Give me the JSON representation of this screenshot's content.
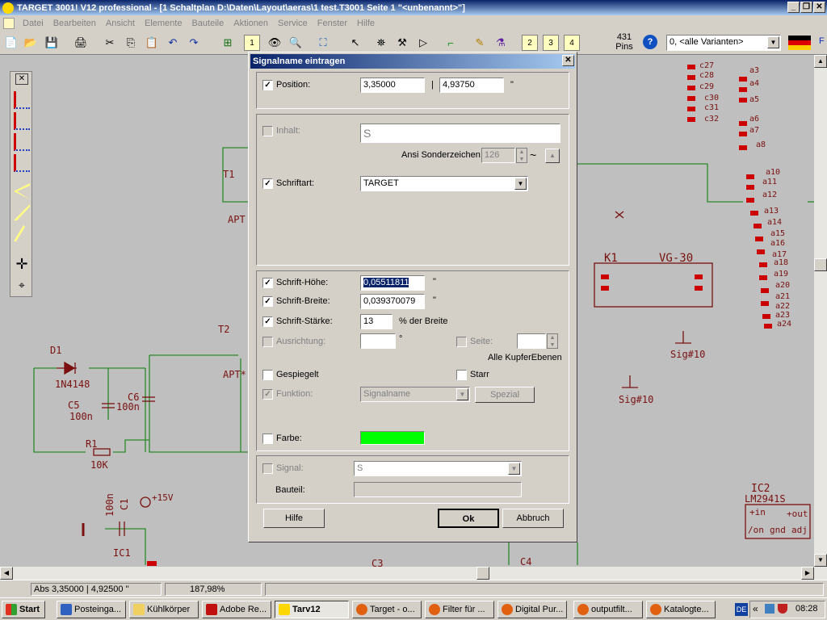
{
  "window": {
    "title": "TARGET 3001! V12 professional - [1 Schaltplan D:\\Daten\\Layout\\aeras\\1 test.T3001 Seite 1 \"<unbenannt>\"]"
  },
  "menu": [
    "Datei",
    "Bearbeiten",
    "Ansicht",
    "Elemente",
    "Bauteile",
    "Aktionen",
    "Service",
    "Fenster",
    "Hilfe"
  ],
  "toolbar": {
    "pins_count": "431",
    "pins_label": "Pins",
    "variant_select": "0, <alle Varianten>",
    "layer_buttons": [
      "1",
      "2",
      "3",
      "4"
    ],
    "help_icon": "?"
  },
  "schematic": {
    "labels": [
      "T1",
      "APT",
      "T2",
      "APT*",
      "D1",
      "1N4148",
      "C5",
      "100n",
      "C6",
      "100n",
      "R1",
      "10K",
      "100n",
      "C1",
      "+15V",
      "IC1",
      "C3",
      "C4",
      "K1",
      "VG-30",
      "Sig#10",
      "Sig#10",
      "IC2",
      "LM2941S",
      "+in",
      "+out",
      "/on",
      "gnd",
      "adj"
    ],
    "pin_labels": [
      "c27",
      "c28",
      "c29",
      "c30",
      "c31",
      "c32",
      "a3",
      "a4",
      "a5",
      "a6",
      "a7",
      "a8",
      "a10",
      "a11",
      "a12",
      "a13",
      "a14",
      "a15",
      "a16",
      "a17",
      "a18",
      "a19",
      "a20",
      "a21",
      "a22",
      "a23",
      "a24"
    ]
  },
  "dialog": {
    "title": "Signalname eintragen",
    "close": "✕",
    "position": {
      "label": "Position:",
      "x": "3,35000",
      "sep": "|",
      "y": "4,93750",
      "unit": "\""
    },
    "inhalt": {
      "label": "Inhalt:",
      "value": "S"
    },
    "ansi": {
      "label": "Ansi Sonderzeichen:",
      "value": "126",
      "tilde": "~"
    },
    "schriftart": {
      "label": "Schriftart:",
      "value": "TARGET"
    },
    "hoehe": {
      "label": "Schrift-Höhe:",
      "value": "0,05511811",
      "unit": "\""
    },
    "breite": {
      "label": "Schrift-Breite:",
      "value": "0,039370079",
      "unit": "\""
    },
    "staerke": {
      "label": "Schrift-Stärke:",
      "value": "13",
      "unit": "% der Breite"
    },
    "ausrichtung": {
      "label": "Ausrichtung:",
      "value": "",
      "unit": "°"
    },
    "seite": {
      "label": "Seite:",
      "value": "",
      "note": "Alle KupferEbenen"
    },
    "gespiegelt": {
      "label": "Gespiegelt"
    },
    "starr": {
      "label": "Starr"
    },
    "funktion": {
      "label": "Funktion:",
      "value": "Signalname",
      "button": "Spezial"
    },
    "farbe": {
      "label": "Farbe:",
      "color": "#00ff00"
    },
    "signal": {
      "label": "Signal:",
      "value": "S"
    },
    "bauteil": {
      "label": "Bauteil:",
      "value": ""
    },
    "buttons": {
      "hilfe": "Hilfe",
      "ok": "Ok",
      "abbruch": "Abbruch"
    }
  },
  "status": {
    "coords": "Abs 3,35000 | 4,92500 ''",
    "zoom": "187,98%"
  },
  "taskbar": {
    "start": "Start",
    "tasks": [
      "Posteinga...",
      "Kühlkörper",
      "Adobe Re...",
      "Tarv12",
      "Target - o...",
      "Filter für ...",
      "Digital Pur...",
      "outputfilt...",
      "Katalogte..."
    ],
    "lang": "DE",
    "clock": "08:28"
  }
}
